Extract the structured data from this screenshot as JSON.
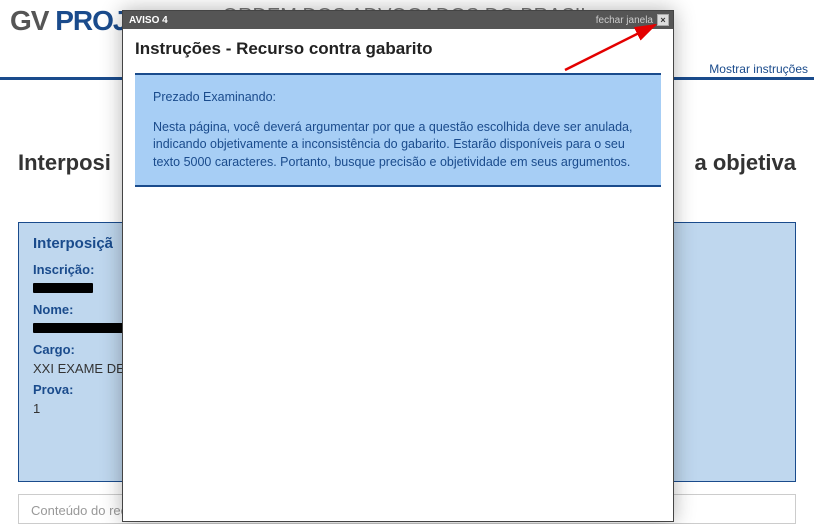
{
  "header": {
    "logo_part1": "GV ",
    "logo_part2": "PROJETOS",
    "org_title": "ORDEM DOS ADVOGADOS DO BRASIL",
    "show_instructions": "Mostrar instruções"
  },
  "page": {
    "title_left": "Interposi",
    "title_right": "a objetiva"
  },
  "info": {
    "header": "Interposiçã",
    "inscricao_label": "Inscrição:",
    "nome_label": "Nome:",
    "cargo_label": "Cargo:",
    "cargo_value": "XXI EXAME DE O",
    "prova_label": "Prova:",
    "prova_value": "1"
  },
  "content_box": {
    "label": "Conteúdo do recurso:"
  },
  "modal": {
    "titlebar": "AVISO 4",
    "close_label": "fechar janela",
    "close_x": "×",
    "heading": "Instruções - Recurso contra gabarito",
    "greeting": "Prezado Examinando:",
    "body": "Nesta página, você deverá argumentar por que a questão escolhida deve ser anulada, indicando objetivamente a inconsistência do gabarito. Estarão disponíveis para o seu texto 5000 caracteres. Portanto, busque precisão e objetividade em seus argumentos."
  }
}
